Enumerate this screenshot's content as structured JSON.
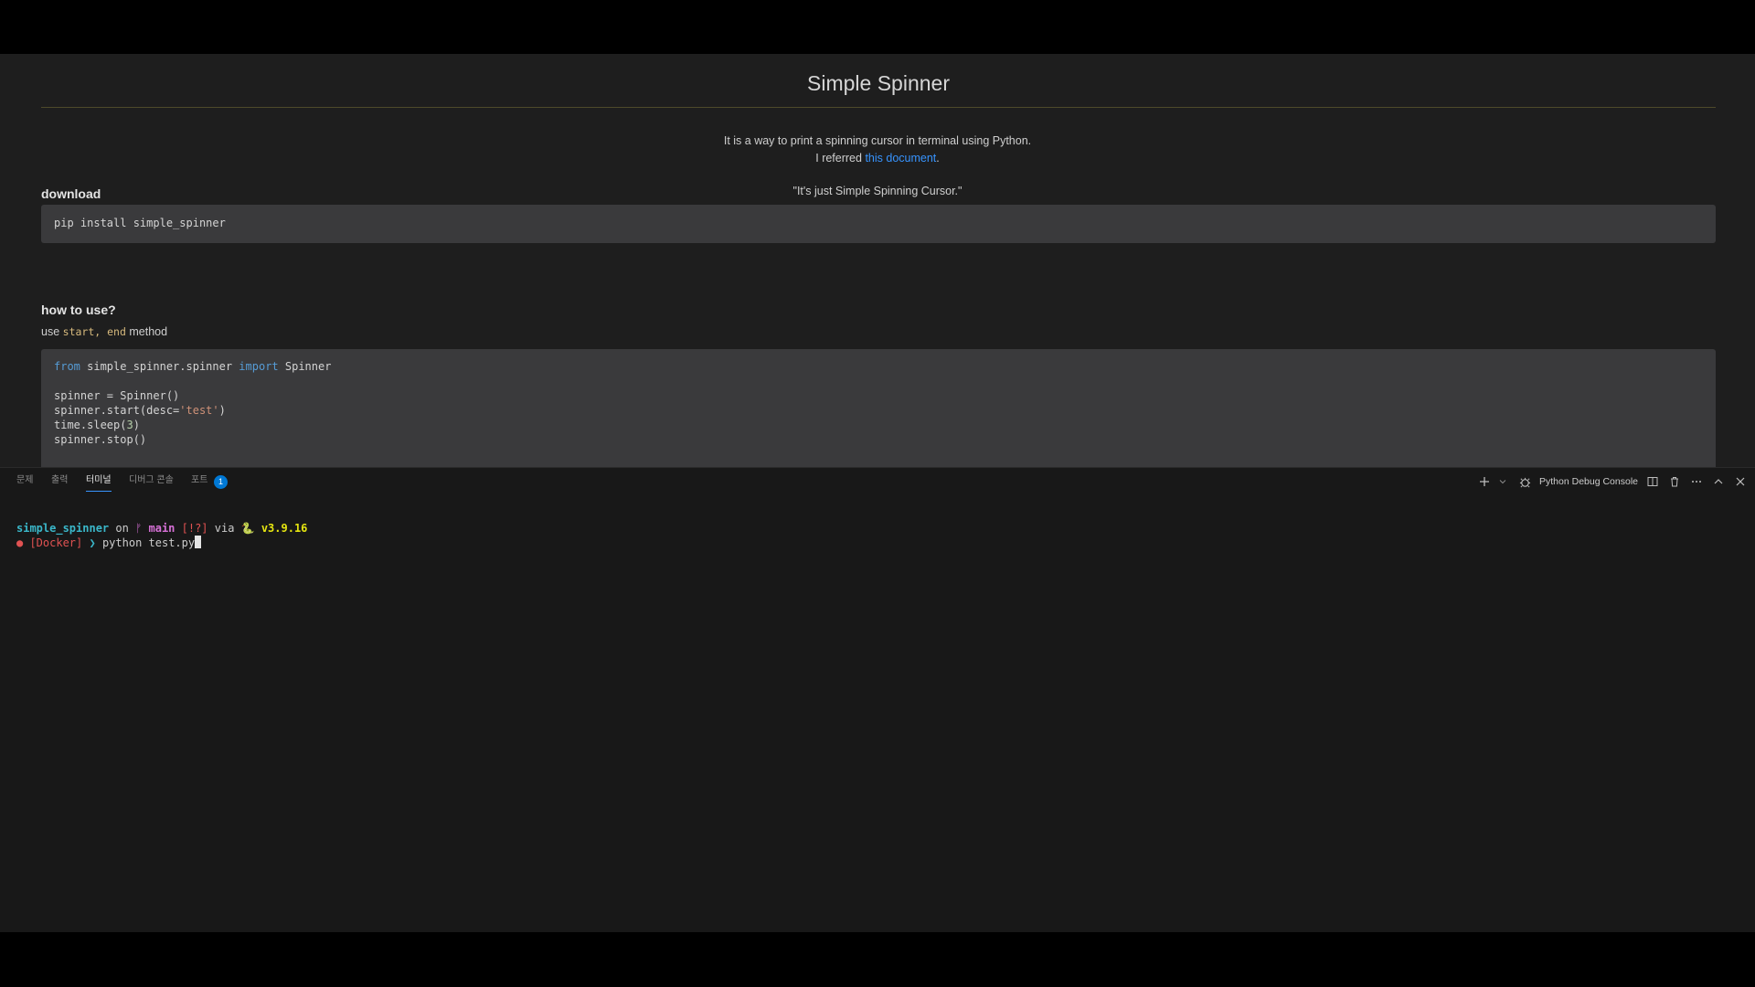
{
  "preview": {
    "title": "Simple Spinner",
    "intro_line1": "It is a way to print a spinning cursor in terminal using Python.",
    "intro_line2_prefix": "I referred ",
    "intro_link": "this document",
    "intro_line2_suffix": ".",
    "quote": "\"It's just Simple Spinning Cursor.\"",
    "download_heading": "download",
    "download_code": "pip install simple_spinner",
    "howto_heading": "how to use?",
    "usage_prefix": "use ",
    "usage_start": "start",
    "usage_comma": ", ",
    "usage_end": "end",
    "usage_suffix": " method",
    "code": {
      "l1_kw1": "from",
      "l1_mod": " simple_spinner.spinner ",
      "l1_kw2": "import",
      "l1_name": " Spinner",
      "l3": "spinner = Spinner()",
      "l4_a": "spinner.start(desc=",
      "l4_str": "'test'",
      "l4_b": ")",
      "l5_a": "time.sleep(",
      "l5_num": "3",
      "l5_b": ")",
      "l6": "spinner.stop()"
    }
  },
  "panel": {
    "tabs": [
      {
        "label": "문제"
      },
      {
        "label": "출력"
      },
      {
        "label": "터미널"
      },
      {
        "label": "디버그 콘솔"
      },
      {
        "label": "포트"
      }
    ],
    "ports_badge": "1",
    "console_name": "Python Debug Console"
  },
  "terminal": {
    "dir": "simple_spinner",
    "on": " on ",
    "branch_icon": "ᚠ",
    "branch": " main",
    "status": " [!?]",
    "via": " via ",
    "py_icon": "🐍",
    "version": " v3.9.16",
    "dot": "●",
    "context": " [Docker]",
    "prompt": " ❯ ",
    "command": "python test.py"
  },
  "colors": {
    "accent": "#3794ff",
    "badge": "#0078d4",
    "background": "#1e1e1e"
  }
}
